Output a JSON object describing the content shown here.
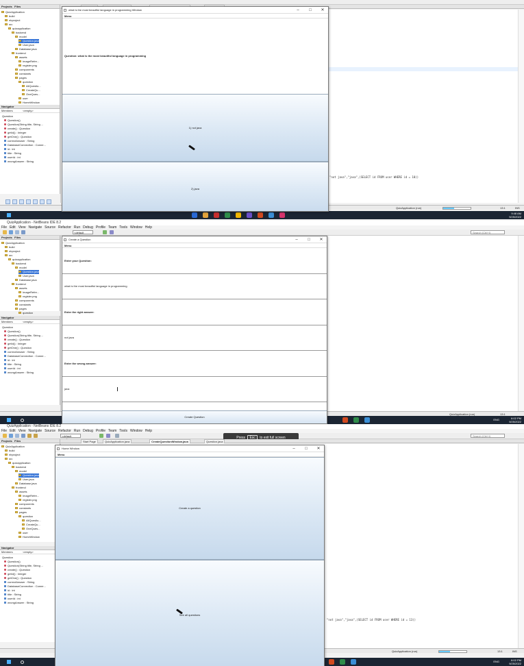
{
  "ide": {
    "title": "QuizApplication - NetBeans IDE 8.2",
    "menu": [
      "File",
      "Edit",
      "View",
      "Navigate",
      "Source",
      "Refactor",
      "Run",
      "Debug",
      "Profile",
      "Team",
      "Tools",
      "Window",
      "Help"
    ],
    "config": "<default config>",
    "search_placeholder": "Search (Ctrl+I)",
    "tabs": [
      "Start Page",
      "QuizApplication.java",
      "CreateQuestionWindow.java",
      "Question.java"
    ],
    "projects_tab": "Projects",
    "files_tab": "Files",
    "tree": [
      {
        "label": "QuizApplication",
        "depth": 0
      },
      {
        "label": "build",
        "depth": 1
      },
      {
        "label": "nbproject",
        "depth": 1
      },
      {
        "label": "src",
        "depth": 1
      },
      {
        "label": "quizapplication",
        "depth": 2
      },
      {
        "label": "backend",
        "depth": 3
      },
      {
        "label": "model",
        "depth": 4
      },
      {
        "label": "Question.java",
        "depth": 5,
        "selected": true
      },
      {
        "label": "User.java",
        "depth": 5
      },
      {
        "label": "Database.java",
        "depth": 4
      },
      {
        "label": "frontend",
        "depth": 3
      },
      {
        "label": "assets",
        "depth": 4
      },
      {
        "label": "ImageRefre...",
        "depth": 5
      },
      {
        "label": "register.png",
        "depth": 5
      },
      {
        "label": "components",
        "depth": 4
      },
      {
        "label": "constants",
        "depth": 4
      },
      {
        "label": "pages",
        "depth": 4
      },
      {
        "label": "question",
        "depth": 5
      },
      {
        "label": "AllQuestio...",
        "depth": 6
      },
      {
        "label": "CreateQu...",
        "depth": 6
      },
      {
        "label": "OneQues...",
        "depth": 6
      },
      {
        "label": "user",
        "depth": 5
      },
      {
        "label": "HomeWindow",
        "depth": 5
      }
    ],
    "navigator": {
      "title": "Navigator",
      "members_label": "Members",
      "filter": "<empty>",
      "class_name": "Question",
      "members": [
        {
          "label": "Question()",
          "kind": "method"
        },
        {
          "label": "Question(String title, String ...",
          "kind": "method"
        },
        {
          "label": "create() : Question",
          "kind": "method"
        },
        {
          "label": "getId() : Integer",
          "kind": "method"
        },
        {
          "label": "getOne() : Question",
          "kind": "method"
        },
        {
          "label": "correctAnswer : String",
          "kind": "field"
        },
        {
          "label": "DatabaseConnection : Conne...",
          "kind": "field"
        },
        {
          "label": "id : int",
          "kind": "field"
        },
        {
          "label": "title : String",
          "kind": "field"
        },
        {
          "label": "userId : int",
          "kind": "field"
        },
        {
          "label": "wrongAnswer : String",
          "kind": "field"
        }
      ]
    },
    "code_snippet": "\"not java\",\"java\",(SELECT id FROM user WHERE id = 10))",
    "code_snippet_3": "\"not java\",\"java\",(SELECT id FROM user WHERE id = 13))",
    "status_run": "QuizApplication (run)",
    "status_running": "running...",
    "status_pos": "13:1",
    "status_ins": "INS"
  },
  "taskbar": {
    "lang": "ENG",
    "clock_1": "9:48 AM\n9/25/2022",
    "clock_2": "6:02 PM\n9/25/2022",
    "clock_3": "6:02 PM\n9/25/2022"
  },
  "window1": {
    "title": "what is the most beautiful language in programming Window",
    "menu": "Menu",
    "question": "Question: what is the most beautiful language in programming",
    "answer1": "1) not java",
    "answer2": "2) java"
  },
  "window2": {
    "title": "Create a Question",
    "menu": "Menu",
    "label_question": "Enter your Question:",
    "value_question": "what is the most beautiful language in programming",
    "label_right": "Enter the right answer:",
    "value_right": "not java",
    "label_wrong": "Enter the wrong answer:",
    "value_wrong": "java",
    "button": "Create Question"
  },
  "window3": {
    "title": "Home Window",
    "menu": "Menu",
    "button_create": "Create a question",
    "button_all": "See all questions"
  },
  "fullscreen_banner": {
    "press": "Press",
    "key": "Esc",
    "rest": "to exit full screen"
  },
  "colors": {
    "selection": "#3875d7",
    "taskbar": "#1b2533",
    "button_gradient_mid": "#dde9f5"
  }
}
